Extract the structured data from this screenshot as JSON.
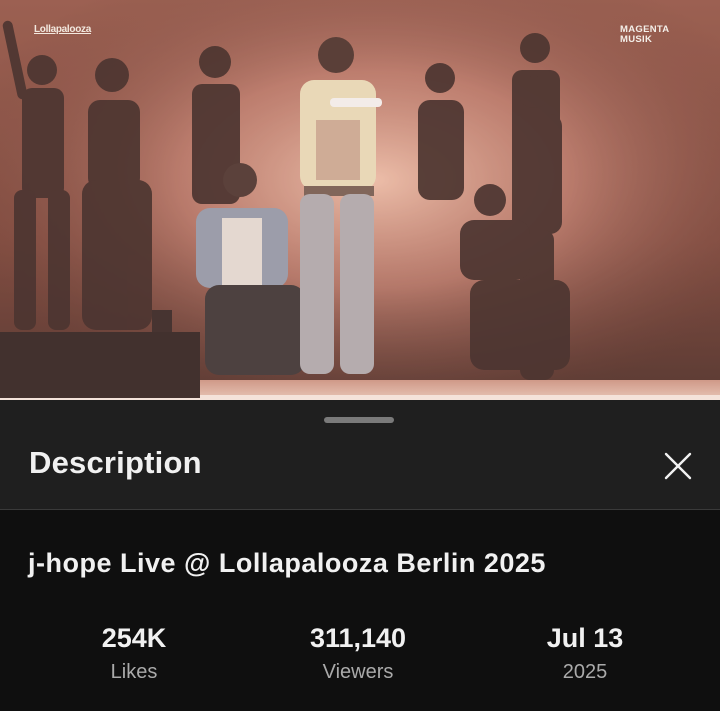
{
  "video": {
    "watermark_left": "Lollapalooza",
    "watermark_right_line1": "MAGENTA",
    "watermark_right_line2": "MUSIK"
  },
  "sheet": {
    "title": "Description",
    "close_icon": "close-icon"
  },
  "description": {
    "video_title": "j-hope Live @ Lollapalooza Berlin 2025",
    "stats": {
      "likes": {
        "value": "254K",
        "label": "Likes"
      },
      "viewers": {
        "value": "311,140",
        "label": "Viewers"
      },
      "date": {
        "value": "Jul 13",
        "label": "2025"
      }
    }
  },
  "colors": {
    "sheet_background": "#1f1f1f",
    "content_background": "#0f0f0f",
    "primary_text": "#f1f1f1",
    "secondary_text": "#aaaaaa"
  }
}
